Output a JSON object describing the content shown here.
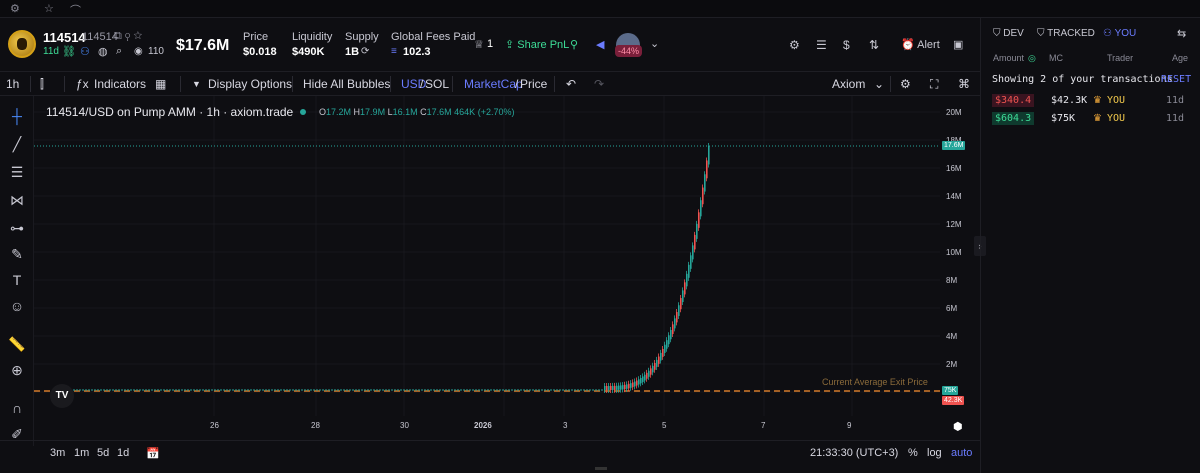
{
  "topbar": {
    "gear": "⚙",
    "star": "☆",
    "chart": "⌒"
  },
  "token": {
    "ticker": "114514",
    "name": "114514",
    "age": "11d",
    "holders": "110",
    "mcap": "$17.6M"
  },
  "stats": [
    {
      "label": "Price",
      "value": "$0.018"
    },
    {
      "label": "Liquidity",
      "value": "$490K"
    },
    {
      "label": "Supply",
      "value": "1B"
    },
    {
      "label": "Global Fees Paid",
      "value": "102.3"
    }
  ],
  "header_actions": {
    "watch_count": "1",
    "share": "Share PnL",
    "pnl_pct": "-44%",
    "alert": "Alert"
  },
  "toolbar": {
    "interval": "1h",
    "indicators": "Indicators",
    "display_options": "Display Options",
    "hide_bubbles": "Hide All Bubbles",
    "usd": "USD",
    "sol": "SOL",
    "mcap": "MarketCap",
    "price": "Price",
    "source": "Axiom"
  },
  "legend": {
    "pair": "114514/USD on Pump AMM · 1h · axiom.trade",
    "o": "17.2M",
    "h": "17.9M",
    "l": "16.1M",
    "c": "17.6M",
    "vol": "464K",
    "chg": "(+2.70%)"
  },
  "annotation": "Current Average Exit Price",
  "yticks": [
    "20M",
    "18M",
    "16M",
    "14M",
    "12M",
    "10M",
    "8M",
    "6M",
    "4M",
    "2M"
  ],
  "xticks": [
    "26",
    "28",
    "30",
    "2026",
    "3",
    "5",
    "7",
    "9"
  ],
  "pricetags": {
    "last": "17.6M",
    "avg": "75K",
    "entry": "42.3K"
  },
  "bottom": {
    "ranges": [
      "3m",
      "1m",
      "5d",
      "1d"
    ],
    "time": "21:33:30 (UTC+3)",
    "pct": "%",
    "log": "log",
    "auto": "auto"
  },
  "right": {
    "tabs": [
      "DEV",
      "TRACKED",
      "YOU"
    ],
    "cols": [
      "Amount",
      "MC",
      "Trader",
      "Age"
    ],
    "showing": "Showing 2 of your transactions",
    "reset": "RESET",
    "rows": [
      {
        "amount": "$340.4",
        "mc": "$42.3K",
        "trader": "YOU",
        "age": "11d",
        "type": "sell"
      },
      {
        "amount": "$604.3",
        "mc": "$75K",
        "trader": "YOU",
        "age": "11d",
        "type": "buy"
      }
    ]
  },
  "colors": {
    "green": "#26a69a",
    "red": "#ef5350",
    "accent": "#526fff"
  }
}
